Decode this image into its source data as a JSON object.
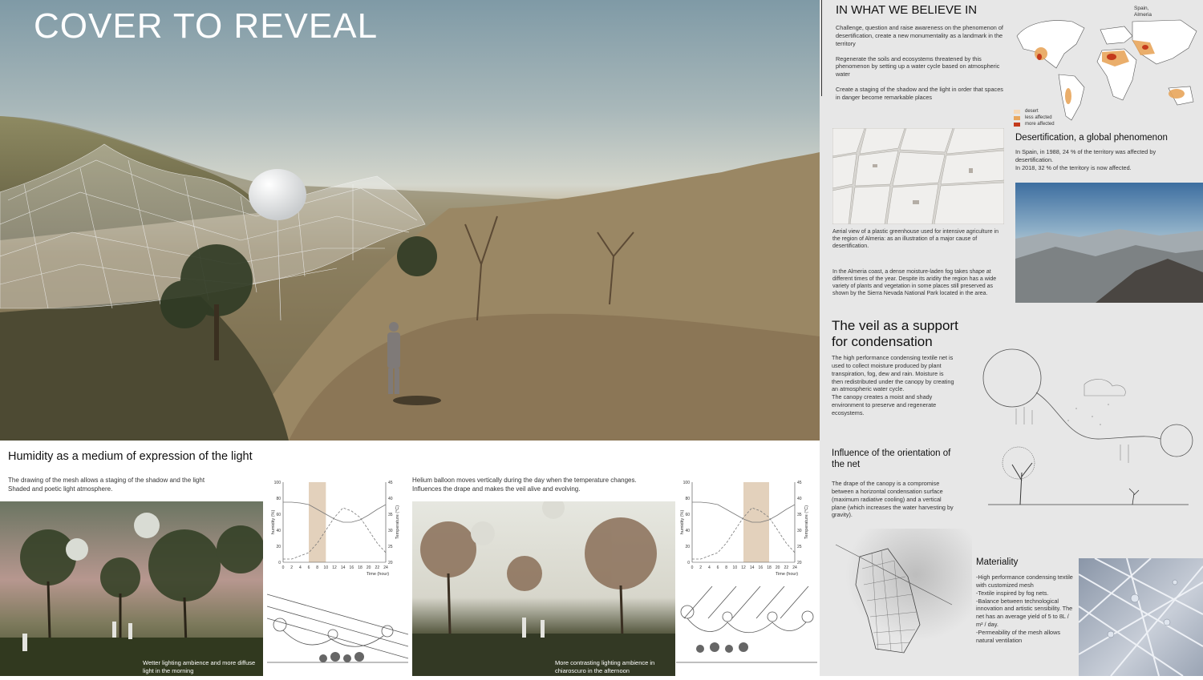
{
  "hero": {
    "title": "COVER TO REVEAL"
  },
  "beliefs": {
    "title": "IN WHAT WE BELIEVE IN",
    "p1": "Challenge, question and raise awareness on the phenomenon of desertification, create a new monumentality as a landmark in the territory",
    "p2": "Regenerate the soils and ecosystems threatened by this phenomenon by setting up a water cycle based on atmospheric water",
    "p3": "Create a staging of the shadow and the light in order that spaces in danger become remarkable places"
  },
  "map": {
    "label": "Spain,\nAlmeria",
    "legend": [
      "desert",
      "less affected",
      "more affected"
    ],
    "legend_colors": [
      "#f5d9b8",
      "#e8a65c",
      "#c43a1c"
    ]
  },
  "aerial": {
    "caption": "Aerial view of a plastic greenhouse used for intensive agriculture in the region of Almeria: as an illustration of a major cause of desertification.",
    "fog_text": "In the Almeria coast, a dense moisture-laden fog takes shape at different times of the year. Despite its aridity the region has a wide variety of plants and vegetation in some places still preserved as shown by the Sierra Nevada National Park located in the area."
  },
  "global": {
    "title": "Desertification, a global phenomenon",
    "p1": "In Spain, in 1988, 24 % of the territory was affected by desertification.",
    "p2": "In 2018, 32 % of the territory is now affected."
  },
  "veil": {
    "title_line1": "The veil as a support",
    "title_line2": "for condensation",
    "p1": "The high performance condensing textile net is used to collect moisture produced by plant transpiration, fog, dew and rain. Moisture is then redistributed under the canopy by creating an atmospheric water cycle.",
    "p2": "The canopy creates a moist and shady environment to preserve and regenerate ecosystems."
  },
  "orientation": {
    "title_line1": "Influence of the orientation of",
    "title_line2": "the net",
    "text": "The drape of the canopy is a compromise between a horizontal condensation surface (maximum radiative cooling) and a vertical plane (which increases the water harvesting by gravity)."
  },
  "materiality": {
    "title": "Materiality",
    "items": [
      "-High performance condensing textile with customized mesh",
      "-Textile inspired by fog nets.",
      "-Balance between technological innovation and artistic sensibility. The net has an average yield of 5 to 8L / m² / day.",
      "-Permeability of the mesh allows natural ventilation"
    ]
  },
  "humidity": {
    "title": "Humidity as a medium of expression of the light",
    "left_line1": "The drawing of the mesh allows a staging of the shadow and the light",
    "left_line2": "Shaded and poetic light atmosphere.",
    "right_line1": "Helium balloon moves vertically during the day when the temperature changes.",
    "right_line2": "Influences the drape and makes the veil alive and evolving.",
    "caption_morning": "Wetter lighting ambience and more diffuse light in the morning",
    "caption_afternoon": "More contrasting lighting ambience in chiaroscuro in the afternoon"
  },
  "chart_data": [
    {
      "type": "line",
      "x": [
        0,
        2,
        4,
        6,
        8,
        10,
        12,
        14,
        16,
        18,
        20,
        22,
        24
      ],
      "series": [
        {
          "values": [
            75,
            75,
            74,
            72,
            66,
            60,
            54,
            50,
            50,
            53,
            59,
            66,
            72
          ]
        },
        {
          "values": [
            21,
            21,
            22,
            23,
            26,
            30,
            34,
            37,
            36,
            34,
            30,
            26,
            23
          ]
        }
      ],
      "highlight": [
        6,
        10
      ],
      "xlabel": "Time (hour)",
      "ylabel": "humidity (%)",
      "y2label": "Temperature (°C)",
      "xticks": [
        "0",
        "2",
        "4",
        "6",
        "8",
        "10",
        "12",
        "14",
        "16",
        "18",
        "20",
        "22",
        "24"
      ],
      "yticks": [
        "0",
        "20",
        "40",
        "60",
        "80",
        "100"
      ],
      "y2ticks": [
        "20",
        "25",
        "30",
        "35",
        "40",
        "45"
      ],
      "ylim": [
        0,
        100
      ],
      "y2lim": [
        20,
        45
      ]
    },
    {
      "type": "line",
      "x": [
        0,
        2,
        4,
        6,
        8,
        10,
        12,
        14,
        16,
        18,
        20,
        22,
        24
      ],
      "series": [
        {
          "values": [
            75,
            75,
            74,
            72,
            66,
            60,
            54,
            50,
            50,
            53,
            59,
            66,
            72
          ]
        },
        {
          "values": [
            21,
            21,
            22,
            23,
            26,
            30,
            34,
            37,
            36,
            34,
            30,
            26,
            23
          ]
        }
      ],
      "highlight": [
        12,
        18
      ],
      "xlabel": "Time (hour)",
      "ylabel": "humidity (%)",
      "y2label": "Temperature (°C)",
      "xticks": [
        "0",
        "2",
        "4",
        "6",
        "8",
        "10",
        "12",
        "14",
        "16",
        "18",
        "20",
        "22",
        "24"
      ],
      "yticks": [
        "0",
        "20",
        "40",
        "60",
        "80",
        "100"
      ],
      "y2ticks": [
        "20",
        "25",
        "30",
        "35",
        "40",
        "45"
      ],
      "ylim": [
        0,
        100
      ],
      "y2lim": [
        20,
        45
      ]
    }
  ]
}
